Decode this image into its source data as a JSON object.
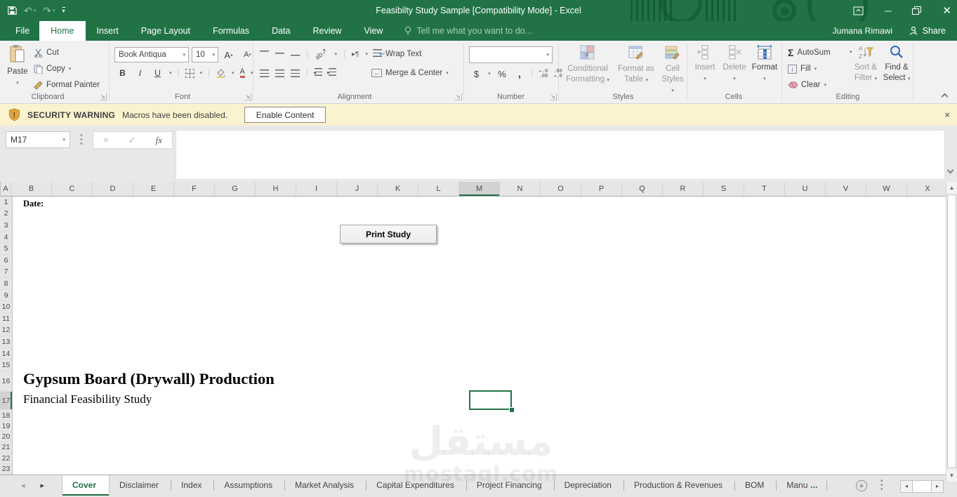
{
  "window": {
    "title": "Feasibilty Study Sample  [Compatibility Mode] - Excel",
    "user": "Jumana Rimawi",
    "share_label": "Share"
  },
  "ribbon_tabs": [
    {
      "label": "File",
      "cls": "file"
    },
    {
      "label": "Home",
      "cls": "active"
    },
    {
      "label": "Insert"
    },
    {
      "label": "Page Layout"
    },
    {
      "label": "Formulas"
    },
    {
      "label": "Data"
    },
    {
      "label": "Review"
    },
    {
      "label": "View"
    }
  ],
  "tell_me": "Tell me what you want to do...",
  "ribbon": {
    "clipboard": {
      "group": "Clipboard",
      "paste": "Paste",
      "cut": "Cut",
      "copy": "Copy",
      "format_painter": "Format Painter"
    },
    "font": {
      "group": "Font",
      "name": "Book Antiqua",
      "size": "10",
      "bold": "B",
      "italic": "I",
      "underline": "U",
      "color_letter": "A",
      "grow": "A",
      "shrink": "A"
    },
    "alignment": {
      "group": "Alignment",
      "wrap": "Wrap Text",
      "merge": "Merge & Center",
      "orient": "ab",
      "direction": "¶"
    },
    "number": {
      "group": "Number",
      "currency": "$",
      "percent": "%",
      "comma": ",",
      "inc_dec": "←.0\n.00",
      "dec_dec": ".00\n→.0"
    },
    "styles": {
      "group": "Styles",
      "conditional_1": "Conditional",
      "conditional_2": "Formatting",
      "table_1": "Format as",
      "table_2": "Table",
      "cellstyles_1": "Cell",
      "cellstyles_2": "Styles"
    },
    "cells": {
      "group": "Cells",
      "insert": "Insert",
      "delete": "Delete",
      "format": "Format"
    },
    "editing": {
      "group": "Editing",
      "autosum": "AutoSum",
      "fill": "Fill",
      "clear": "Clear",
      "sort_1": "Sort &",
      "sort_2": "Filter",
      "find_1": "Find &",
      "find_2": "Select"
    }
  },
  "security": {
    "title": "SECURITY WARNING",
    "message": "Macros have been disabled.",
    "action": "Enable Content"
  },
  "formula_bar": {
    "name_box": "M17",
    "fx": "fx"
  },
  "sheet": {
    "columns": [
      "A",
      "B",
      "C",
      "D",
      "E",
      "F",
      "G",
      "H",
      "I",
      "J",
      "K",
      "L",
      "M",
      "N",
      "O",
      "P",
      "Q",
      "R",
      "S",
      "T",
      "U",
      "V",
      "W",
      "X"
    ],
    "rows": [
      "1",
      "2",
      "3",
      "4",
      "5",
      "6",
      "7",
      "8",
      "9",
      "10",
      "11",
      "12",
      "13",
      "14",
      "15",
      "16",
      "17",
      "18",
      "19",
      "20",
      "21",
      "22",
      "23"
    ],
    "selected_cell": "M17",
    "selected_column": "M",
    "selected_row": "17",
    "date_label": "Date:",
    "print_button": "Print Study",
    "title": "Gypsum Board (Drywall) Production",
    "subtitle": "Financial Feasibility Study"
  },
  "sheet_tabs": [
    {
      "label": "Cover",
      "cls": "active"
    },
    {
      "label": "Disclaimer"
    },
    {
      "label": "Index"
    },
    {
      "label": "Assumptions"
    },
    {
      "label": "Market Analysis"
    },
    {
      "label": "Capital Expenditures"
    },
    {
      "label": "Project Financing"
    },
    {
      "label": "Depreciation"
    },
    {
      "label": "Production & Revenues"
    },
    {
      "label": "BOM"
    },
    {
      "label": "Manu",
      "suffix": "..."
    }
  ],
  "watermark": {
    "line1": "مستقل",
    "line2": "mostaql.com"
  },
  "colors": {
    "excel_green": "#217346",
    "active_accent": "#1e7145",
    "warning_bg": "#fbf3cf",
    "ribbon_bg": "#f1f1f1"
  }
}
